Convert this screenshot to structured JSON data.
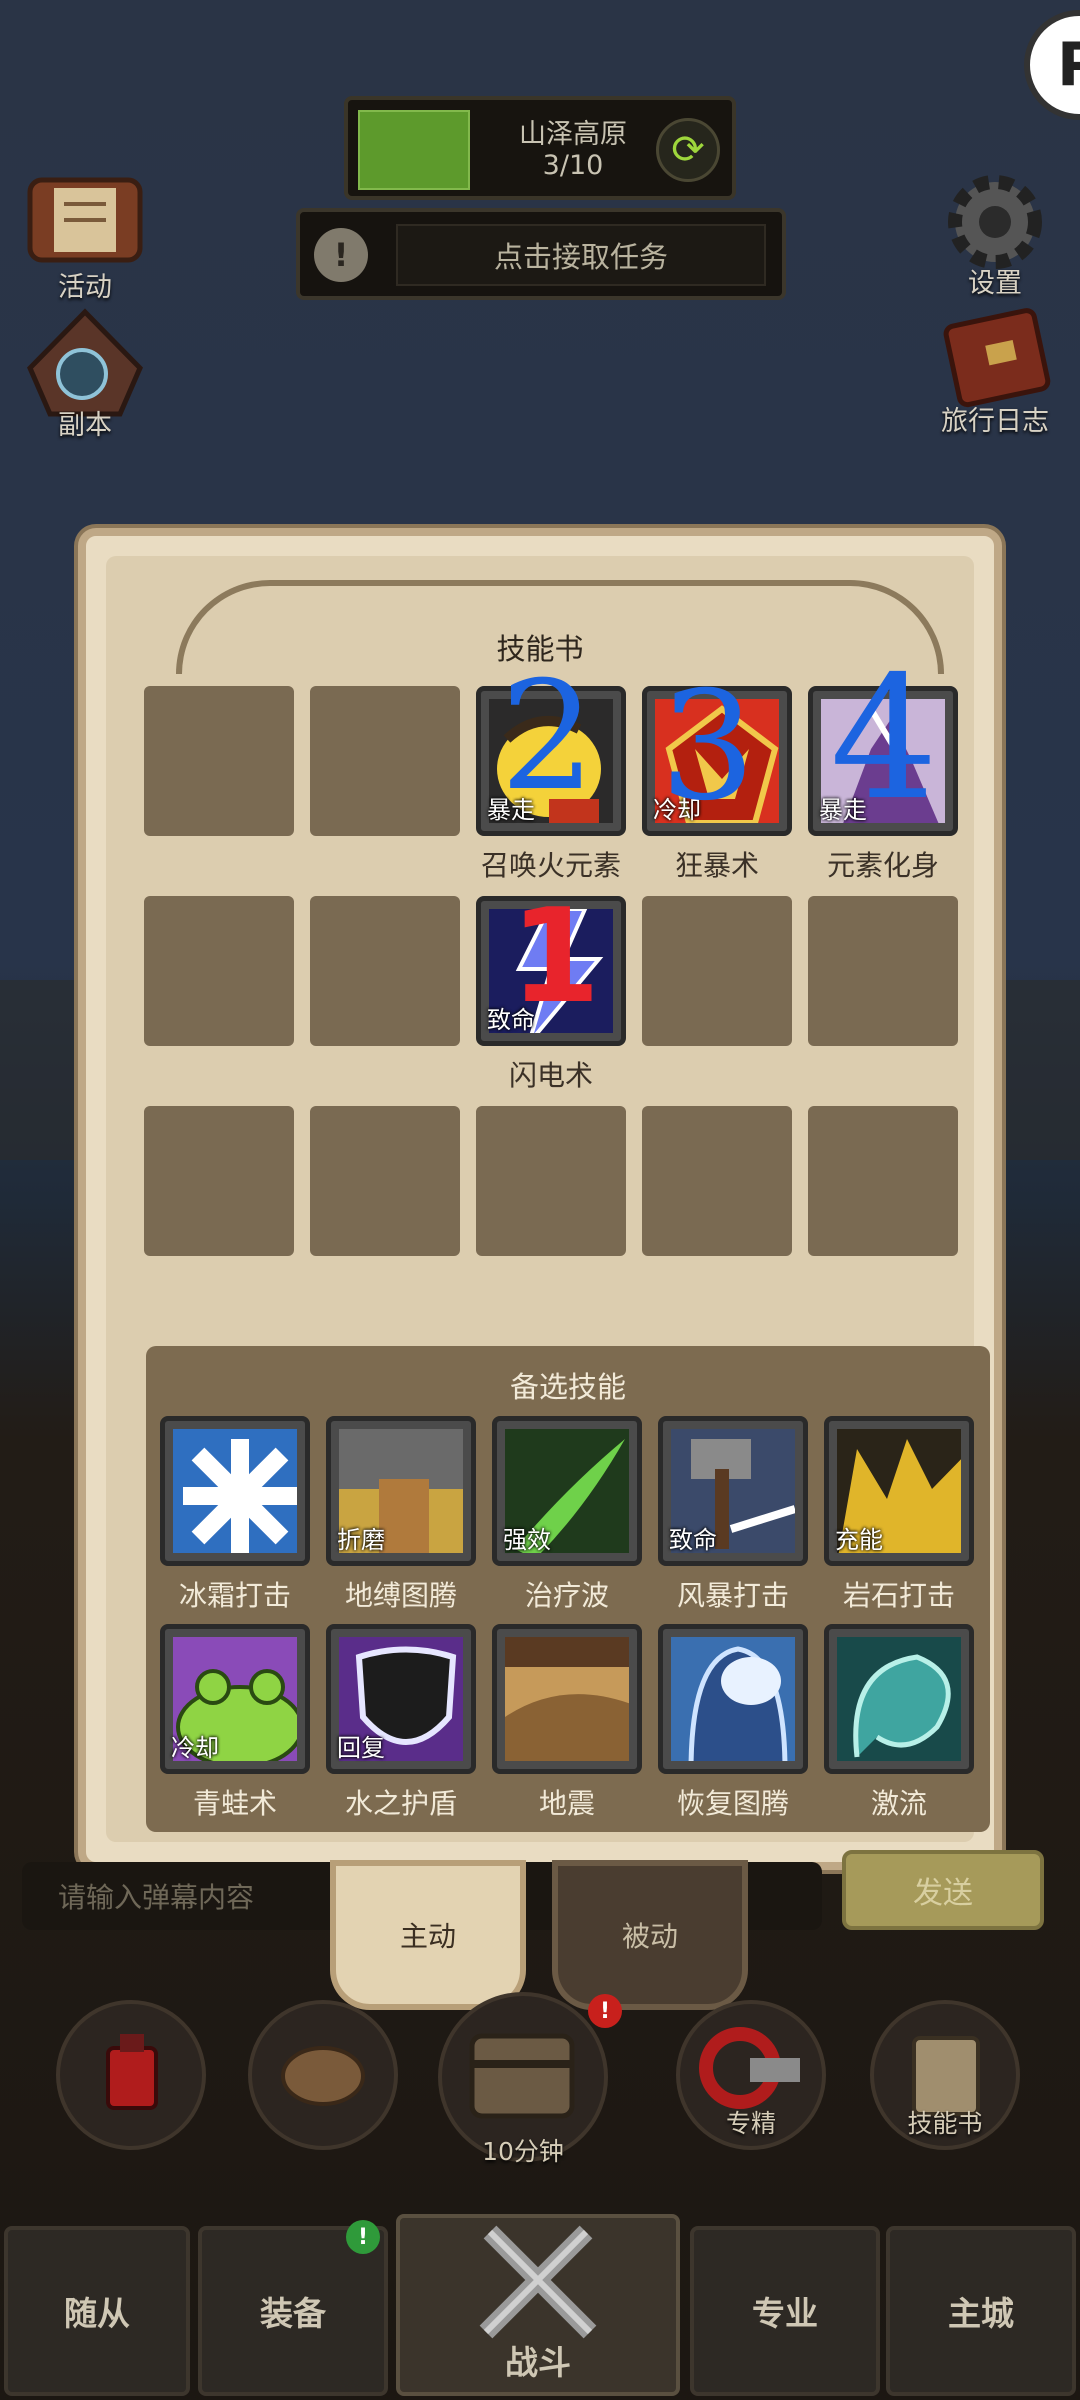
{
  "hud": {
    "activity": "活动",
    "dungeon": "副本",
    "settings": "设置",
    "travel_log": "旅行日志",
    "zone_name": "山泽高原",
    "zone_progress": "3/10",
    "quest": "点击接取任务"
  },
  "skill_book": {
    "title": "技能书",
    "equipped": [
      {
        "name": "召唤火元素",
        "tag": "暴走"
      },
      {
        "name": "狂暴术",
        "tag": "冷却"
      },
      {
        "name": "元素化身",
        "tag": "暴走"
      },
      {
        "name": "闪电术",
        "tag": "致命"
      }
    ],
    "alt_title": "备选技能",
    "alternates": [
      {
        "name": "冰霜打击",
        "tag": ""
      },
      {
        "name": "地缚图腾",
        "tag": "折磨"
      },
      {
        "name": "治疗波",
        "tag": "强效"
      },
      {
        "name": "风暴打击",
        "tag": "致命"
      },
      {
        "name": "岩石打击",
        "tag": "充能"
      },
      {
        "name": "青蛙术",
        "tag": "冷却"
      },
      {
        "name": "水之护盾",
        "tag": "回复"
      },
      {
        "name": "地震",
        "tag": ""
      },
      {
        "name": "恢复图腾",
        "tag": ""
      },
      {
        "name": "激流",
        "tag": ""
      }
    ]
  },
  "annotations": {
    "n1": "1",
    "n2": "2",
    "n3": "3",
    "n4": "4"
  },
  "chat": {
    "placeholder": "请输入弹幕内容",
    "send": "发送"
  },
  "tabs": {
    "active": "主动",
    "passive": "被动"
  },
  "actions": {
    "timer": "10分钟",
    "specialize": "专精",
    "skill_book": "技能书"
  },
  "nav": {
    "followers": "随从",
    "equipment": "装备",
    "battle": "战斗",
    "profession": "专业",
    "main_city": "主城"
  },
  "badges": {
    "chest": "!",
    "equipment": "!"
  },
  "logo": "P"
}
